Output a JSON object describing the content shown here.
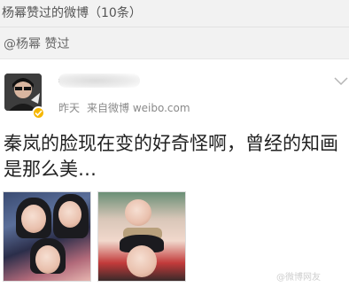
{
  "header": {
    "title": "杨幂赞过的微博（10条）"
  },
  "subheader": {
    "label": "@杨幂 赞过"
  },
  "post": {
    "time": "昨天",
    "source": "来自微博 weibo.com",
    "text": "秦岚的脸现在变的好奇怪啊，曾经的知画是那么美…",
    "images": [
      "photo-1",
      "photo-2"
    ]
  },
  "watermark": {
    "text": "@微博网友"
  },
  "icons": {
    "verified": "verified-badge-icon",
    "more": "chevron-down-icon"
  },
  "colors": {
    "background": "#f2f2f2",
    "card": "#ffffff",
    "verified": "#f6b700",
    "meta": "#8a8a8a"
  }
}
